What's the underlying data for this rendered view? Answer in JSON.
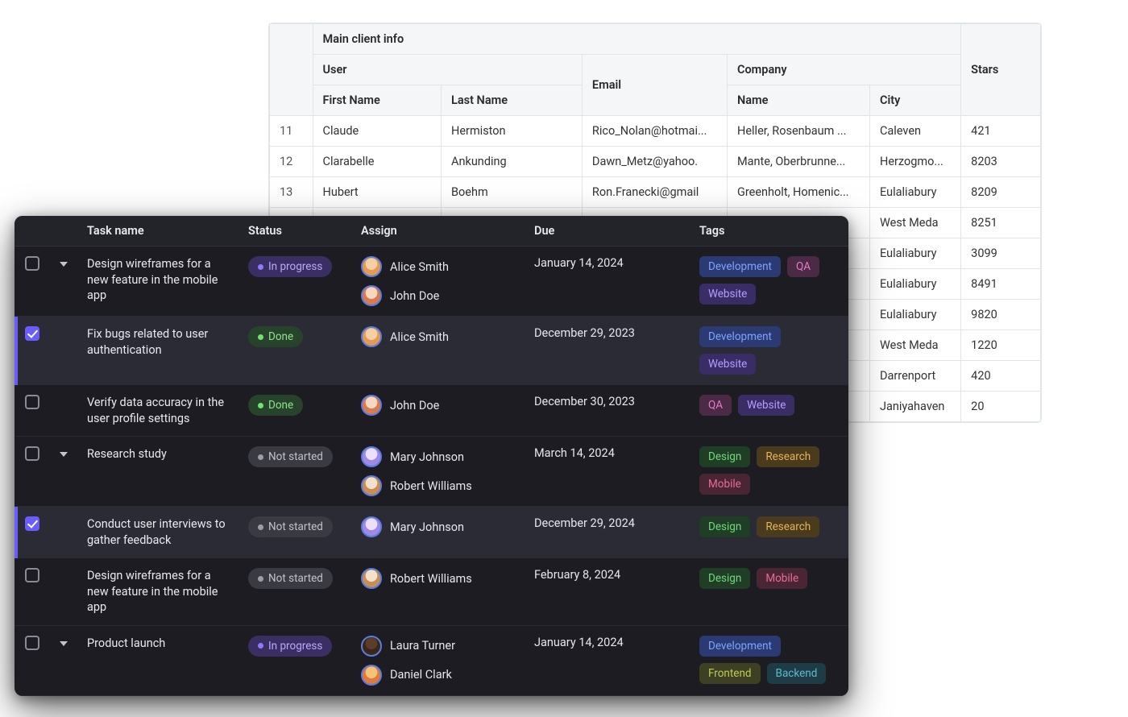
{
  "lightTable": {
    "groupHeader": "Main client info",
    "colGroups": {
      "user": "User",
      "company": "Company"
    },
    "cols": {
      "email": "Email",
      "stars": "Stars",
      "firstName": "First Name",
      "lastName": "Last Name",
      "compName": "Name",
      "city": "City"
    },
    "rows": [
      {
        "idx": "11",
        "first": "Claude",
        "last": "Hermiston",
        "email": "Rico_Nolan@hotmai...",
        "company": "Heller, Rosenbaum ...",
        "city": "Caleven",
        "stars": "421"
      },
      {
        "idx": "12",
        "first": "Clarabelle",
        "last": "Ankunding",
        "email": "Dawn_Metz@yahoo.",
        "company": "Mante, Oberbrunne...",
        "city": "Herzogmo...",
        "stars": "8203"
      },
      {
        "idx": "13",
        "first": "Hubert",
        "last": "Boehm",
        "email": "Ron.Franecki@gmail",
        "company": "Greenholt, Homenic...",
        "city": "Eulaliabury",
        "stars": "8209"
      },
      {
        "idx": "",
        "first": "",
        "last": "",
        "email": "",
        "company": "",
        "city": "West Meda",
        "stars": "8251"
      },
      {
        "idx": "",
        "first": "",
        "last": "",
        "email": "",
        "company": ".",
        "city": "Eulaliabury",
        "stars": "3099"
      },
      {
        "idx": "",
        "first": "",
        "last": "",
        "email": "",
        "company": "",
        "city": "Eulaliabury",
        "stars": "8491"
      },
      {
        "idx": "",
        "first": "",
        "last": "",
        "email": "",
        "company": "",
        "city": "Eulaliabury",
        "stars": "9820"
      },
      {
        "idx": "",
        "first": "",
        "last": "",
        "email": "",
        "company": "",
        "city": "West Meda",
        "stars": "1220"
      },
      {
        "idx": "",
        "first": "",
        "last": "",
        "email": "",
        "company": "",
        "city": "Darrenport",
        "stars": "420"
      },
      {
        "idx": "",
        "first": "",
        "last": "",
        "email": "",
        "company": "",
        "city": "Janiyahaven",
        "stars": "20"
      }
    ]
  },
  "darkTable": {
    "cols": {
      "task": "Task name",
      "status": "Status",
      "assign": "Assign",
      "due": "Due",
      "tags": "Tags"
    },
    "statusLabels": {
      "progress": "In progress",
      "done": "Done",
      "notstarted": "Not started"
    },
    "tagLabels": {
      "dev": "Development",
      "qa": "QA",
      "web": "Website",
      "des": "Design",
      "res": "Research",
      "mob": "Mobile",
      "fe": "Frontend",
      "be": "Backend"
    },
    "rows": [
      {
        "checked": false,
        "caret": true,
        "task": "Design wireframes for a new feature in the mobile app",
        "status": "progress",
        "assignees": [
          {
            "name": "Alice Smith",
            "av": "a"
          },
          {
            "name": "John Doe",
            "av": "b"
          }
        ],
        "due": "January 14, 2024",
        "tags": [
          "dev",
          "qa",
          "web"
        ]
      },
      {
        "checked": true,
        "caret": false,
        "selected": true,
        "task": "Fix bugs related to user authentication",
        "status": "done",
        "assignees": [
          {
            "name": "Alice Smith",
            "av": "a"
          }
        ],
        "due": "December 29, 2023",
        "tags": [
          "dev",
          "web"
        ]
      },
      {
        "checked": false,
        "caret": false,
        "task": "Verify data accuracy in the user profile settings",
        "status": "done",
        "assignees": [
          {
            "name": "John Doe",
            "av": "b"
          }
        ],
        "due": "December 30, 2023",
        "tags": [
          "qa",
          "web"
        ]
      },
      {
        "checked": false,
        "caret": true,
        "task": "Research study",
        "status": "notstarted",
        "assignees": [
          {
            "name": "Mary Johnson",
            "av": "c"
          },
          {
            "name": "Robert Williams",
            "av": "d"
          }
        ],
        "due": "March 14, 2024",
        "tags": [
          "des",
          "res",
          "mob"
        ]
      },
      {
        "checked": true,
        "caret": false,
        "selected": true,
        "task": "Conduct user interviews to gather feedback",
        "status": "notstarted",
        "assignees": [
          {
            "name": "Mary Johnson",
            "av": "c"
          }
        ],
        "due": "December 29, 2024",
        "tags": [
          "des",
          "res"
        ]
      },
      {
        "checked": false,
        "caret": false,
        "task": "Design wireframes for a new feature in the mobile app",
        "status": "notstarted",
        "assignees": [
          {
            "name": "Robert Williams",
            "av": "d"
          }
        ],
        "due": "February 8, 2024",
        "tags": [
          "des",
          "mob"
        ]
      },
      {
        "checked": false,
        "caret": true,
        "task": "Product launch",
        "status": "progress",
        "assignees": [
          {
            "name": "Laura Turner",
            "av": "e"
          },
          {
            "name": "Daniel Clark",
            "av": "f"
          }
        ],
        "due": "January 14, 2024",
        "tags": [
          "dev",
          "fe",
          "be"
        ]
      }
    ]
  }
}
